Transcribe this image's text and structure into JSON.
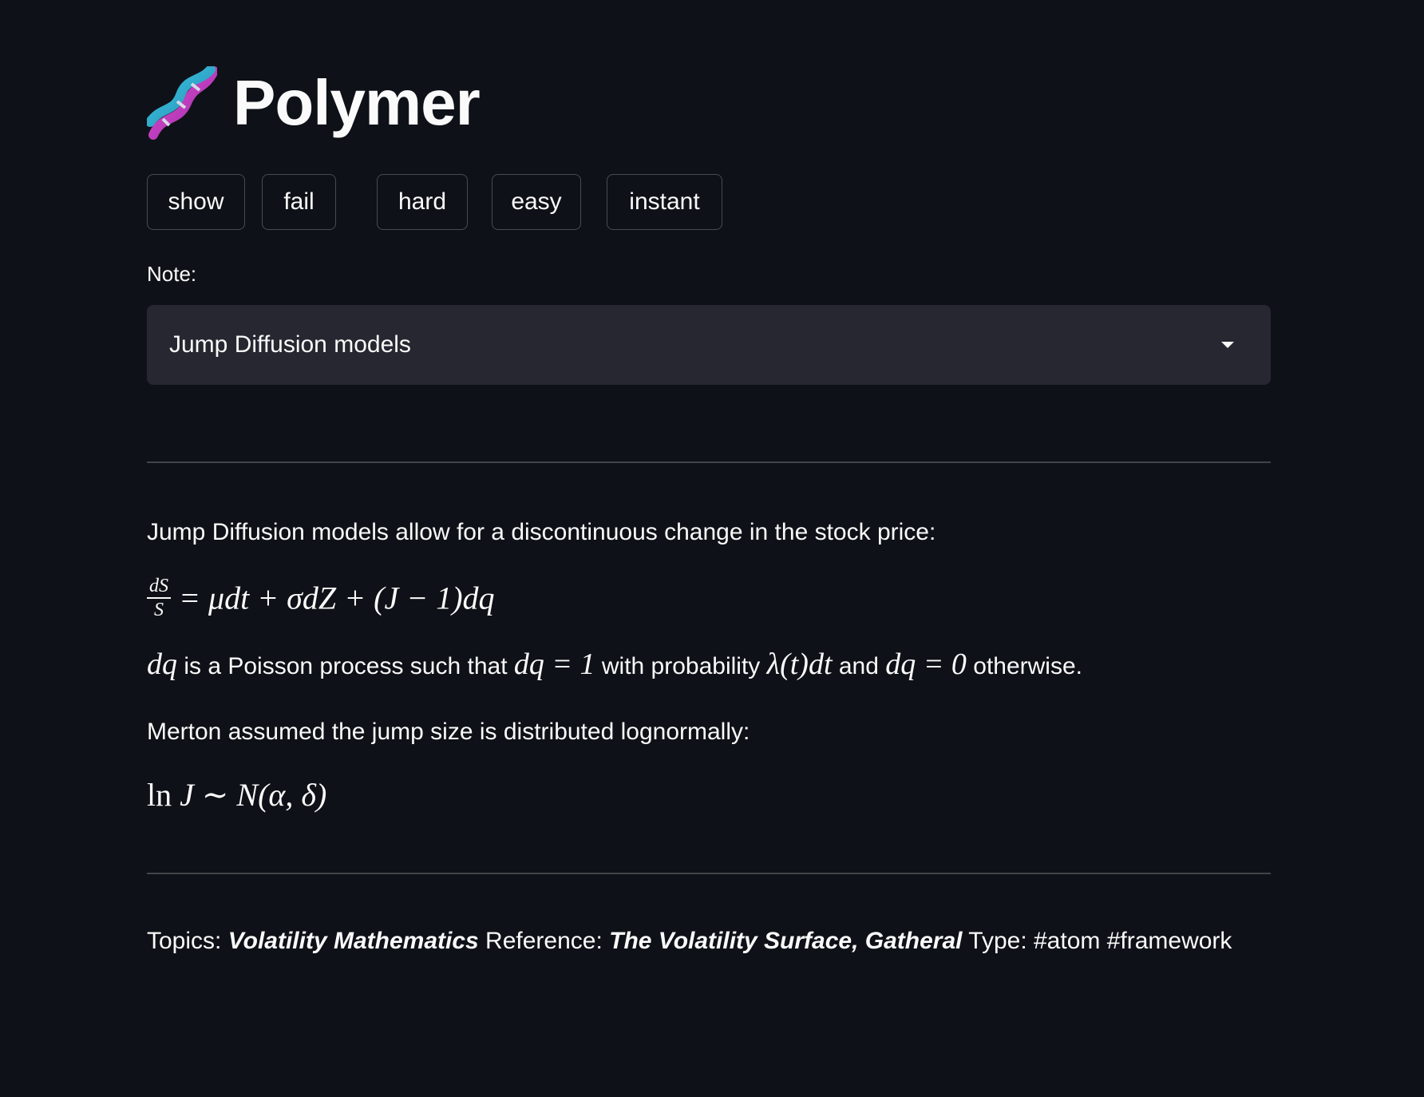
{
  "header": {
    "title": "Polymer",
    "icon": "dna-icon"
  },
  "buttons": {
    "show": "show",
    "fail": "fail",
    "hard": "hard",
    "easy": "easy",
    "instant": "instant"
  },
  "note": {
    "label": "Note:",
    "selected": "Jump Diffusion models"
  },
  "content": {
    "intro": "Jump Diffusion models allow for a discontinuous change in the stock price:",
    "eq1": {
      "num": "dS",
      "den": "S",
      "rhs": "= μdt + σdZ + (J − 1)dq"
    },
    "line2": {
      "dq": "dq",
      "t1": " is a Poisson process such that ",
      "m1": "dq = 1",
      "t2": " with probability ",
      "m2": "λ(t)dt",
      "t3": " and ",
      "m3": "dq = 0",
      "t4": " otherwise."
    },
    "merton": "Merton assumed the jump size is distributed lognormally:",
    "eq2": {
      "ln": "ln",
      "rhs": " J ∼ N(α, δ)"
    }
  },
  "footer": {
    "topics_label": "Topics: ",
    "topics_value": "Volatility Mathematics",
    "reference_label": " Reference: ",
    "reference_value": "The Volatility Surface, Gatheral",
    "type_label": " Type: ",
    "type_value": "#atom #framework"
  },
  "colors": {
    "background": "#0e1117",
    "select_bg": "#262730",
    "text": "#fafafa"
  }
}
